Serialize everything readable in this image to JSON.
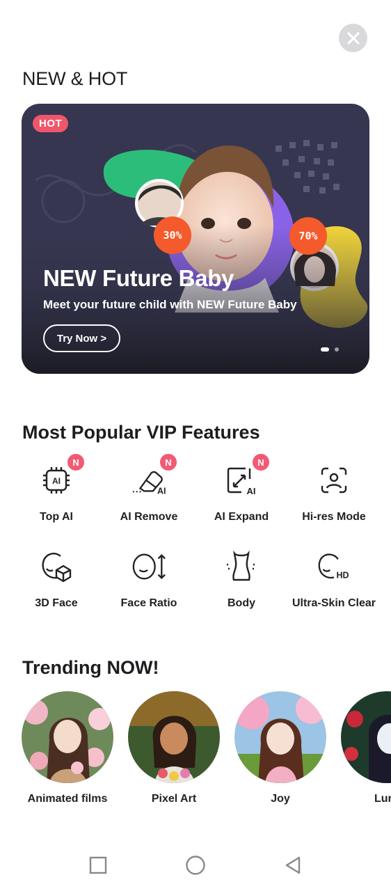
{
  "header": {
    "close_icon": "close-icon"
  },
  "new_hot": {
    "title": "NEW & HOT",
    "banner": {
      "badge": "HOT",
      "title": "NEW Future Baby",
      "subtitle": "Meet your future child with NEW Future Baby",
      "button_label": "Try Now >",
      "left_percent": "30%",
      "right_percent": "70%",
      "page_count": 2,
      "active_page": 1
    }
  },
  "vip": {
    "title": "Most Popular VIP Features",
    "features": [
      {
        "label": "Top AI",
        "icon": "ai-chip-icon",
        "new": true,
        "badge": "N"
      },
      {
        "label": "AI Remove",
        "icon": "eraser-ai-icon",
        "new": true,
        "badge": "N"
      },
      {
        "label": "AI Expand",
        "icon": "expand-ai-icon",
        "new": true,
        "badge": "N"
      },
      {
        "label": "Hi-res Mode",
        "icon": "face-scan-icon",
        "new": false
      },
      {
        "label": "3D Face",
        "icon": "face-3d-icon",
        "new": false
      },
      {
        "label": "Face Ratio",
        "icon": "face-ratio-icon",
        "new": false
      },
      {
        "label": "Body",
        "icon": "body-icon",
        "new": false
      },
      {
        "label": "Ultra-Skin Clear",
        "icon": "face-hd-icon",
        "new": false
      }
    ]
  },
  "trending": {
    "title": "Trending NOW!",
    "items": [
      {
        "label": "Animated films"
      },
      {
        "label": "Pixel Art"
      },
      {
        "label": "Joy"
      },
      {
        "label": "Lur"
      }
    ]
  },
  "nav": {
    "recent": "square-icon",
    "home": "circle-icon",
    "back": "triangle-back-icon"
  }
}
